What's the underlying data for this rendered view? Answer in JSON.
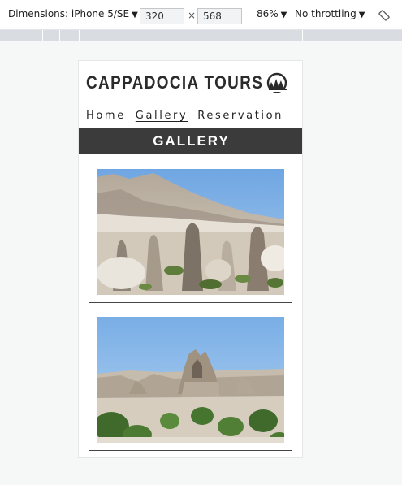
{
  "devtools": {
    "dimensions_label": "Dimensions: iPhone 5/SE",
    "width": "320",
    "separator": "×",
    "height": "568",
    "zoom": "86%",
    "throttling": "No throttling",
    "rotate_icon": "rotate-icon"
  },
  "site": {
    "brand": "CAPPADOCIA TOURS",
    "logo_icon": "fairy-chimney-logo-icon",
    "nav": [
      {
        "label": "Home",
        "active": false
      },
      {
        "label": "Gallery",
        "active": true
      },
      {
        "label": "Reservation",
        "active": false
      }
    ],
    "section_title": "GALLERY",
    "colors": {
      "band": "#3b3b3b",
      "sky": "#7fb1e6",
      "rock": "#c9c0b4"
    }
  }
}
